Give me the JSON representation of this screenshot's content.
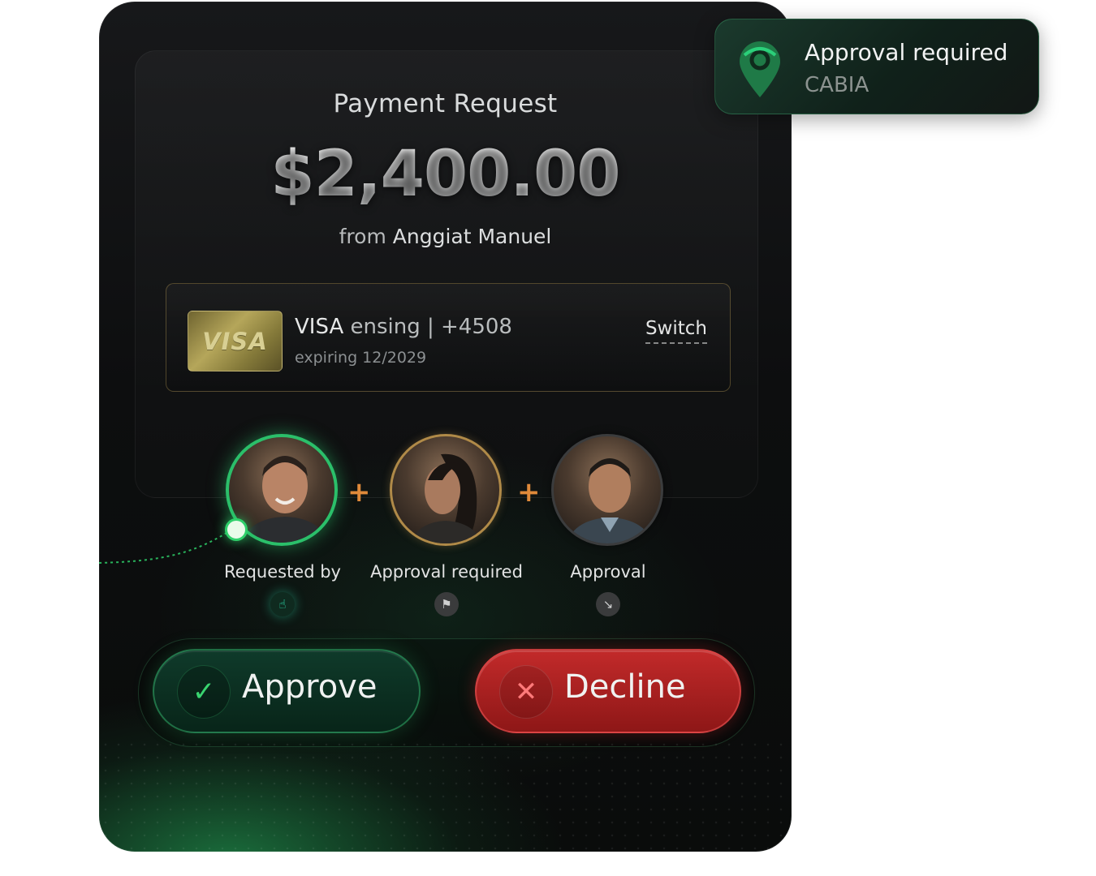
{
  "request": {
    "title": "Payment Request",
    "amount": "$2,400.00",
    "from_prefix": "from",
    "from_name": "Anggiat Manuel"
  },
  "payment_method": {
    "card_brand": "VISA",
    "line_brand": "VISA",
    "line_ending": "ensing | +4508",
    "expiry": "expiring 12/2029",
    "switch_label": "Switch"
  },
  "approvers": [
    {
      "label": "Requested by",
      "status_icon": "hand-pointer-icon",
      "ring": "green"
    },
    {
      "label": "Approval required",
      "status_icon": "flag-icon",
      "ring": "gold"
    },
    {
      "label": "Approval",
      "status_icon": "down-right-arrow-icon",
      "ring": "gray"
    }
  ],
  "plus_sign": "+",
  "actions": {
    "approve_label": "Approve",
    "decline_label": "Decline",
    "approve_icon": "✓",
    "decline_icon": "✕"
  },
  "toast": {
    "title": "Approval required",
    "subtitle": "CABIA",
    "icon": "location-pin-icon"
  },
  "colors": {
    "accent_green": "#2bbf6a",
    "decline_red": "#c22a2a",
    "plus_orange": "#e08a3a"
  }
}
